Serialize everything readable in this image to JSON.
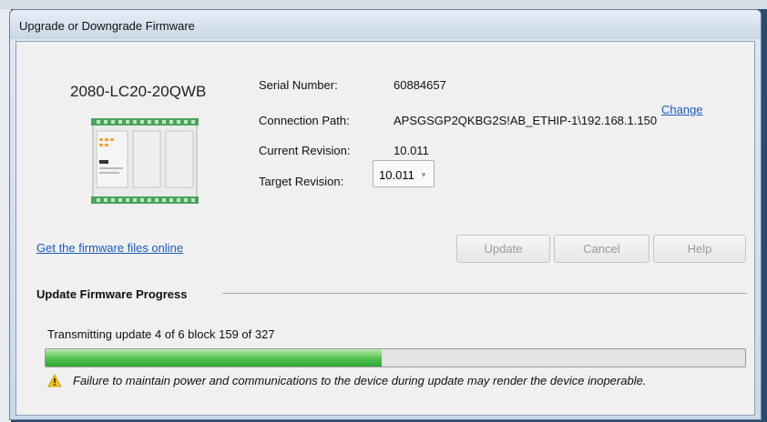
{
  "dialog": {
    "title": "Upgrade or Downgrade Firmware"
  },
  "device": {
    "model": "2080-LC20-20QWB"
  },
  "details": {
    "serial_label": "Serial Number:",
    "serial_value": "60884657",
    "path_label": "Connection Path:",
    "path_value": "APSGSGP2QKBG2S!AB_ETHIP-1\\192.168.1.150",
    "change_link": "Change",
    "current_label": "Current Revision:",
    "current_value": "10.011",
    "target_label": "Target Revision:",
    "target_value": "10.011"
  },
  "actions": {
    "get_firmware_link": "Get the firmware files online",
    "update": "Update",
    "cancel": "Cancel",
    "help": "Help"
  },
  "progress": {
    "section_title": "Update Firmware Progress",
    "status": "Transmitting update 4 of 6  block 159 of 327",
    "fraction": 0.48,
    "warning": "Failure to maintain power and communications to the device during update may render the device inoperable."
  },
  "colors": {
    "link": "#1a5bbf",
    "progress": "#4fc04a",
    "warning": "#f2c21a"
  }
}
